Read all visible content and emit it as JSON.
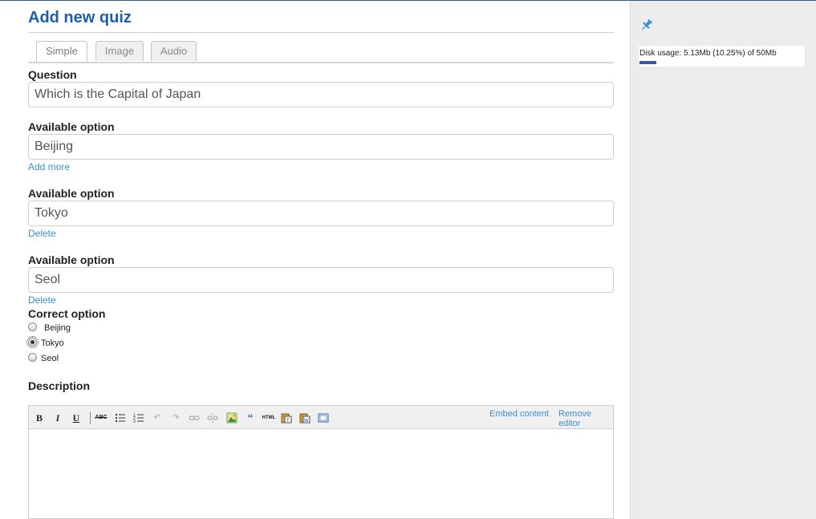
{
  "page": {
    "title": "Add new quiz"
  },
  "tabs": [
    {
      "label": "Simple",
      "active": true
    },
    {
      "label": "Image",
      "active": false
    },
    {
      "label": "Audio",
      "active": false
    }
  ],
  "question": {
    "label": "Question",
    "value": "Which is the Capital of Japan"
  },
  "options": [
    {
      "label": "Available option",
      "value": "Beijing",
      "action": "Add more"
    },
    {
      "label": "Available option",
      "value": "Tokyo",
      "action": "Delete"
    },
    {
      "label": "Available option",
      "value": "Seol",
      "action": "Delete"
    }
  ],
  "correct_option": {
    "label": "Correct option",
    "choices": [
      "Beijing",
      "Tokyo",
      "Seol"
    ],
    "selected": "Tokyo"
  },
  "description": {
    "label": "Description"
  },
  "editor": {
    "toolbar": {
      "bold": "B",
      "italic": "I",
      "underline": "U",
      "spellcheck": "ABC",
      "html": "HTML",
      "icons": [
        "bold-icon",
        "italic-icon",
        "underline-icon",
        "spellcheck-icon",
        "bulleted-list-icon",
        "numbered-list-icon",
        "undo-icon",
        "redo-icon",
        "link-icon",
        "unlink-icon",
        "insert-image-icon",
        "blockquote-icon",
        "html-source-icon",
        "paste-text-icon",
        "paste-word-icon",
        "fullscreen-icon"
      ]
    },
    "embed_label": "Embed content",
    "remove_label": "Remove editor"
  },
  "sidebar": {
    "pin_icon": "pin-icon",
    "disk_usage": {
      "text": "Disk usage: 5.13Mb (10.25%) of 50Mb",
      "fraction": 0.1025,
      "bar_color": "#3355aa"
    }
  },
  "colors": {
    "title": "#1f5fa8",
    "link": "#3d8fd3",
    "sidebar_bg": "#ececec"
  }
}
